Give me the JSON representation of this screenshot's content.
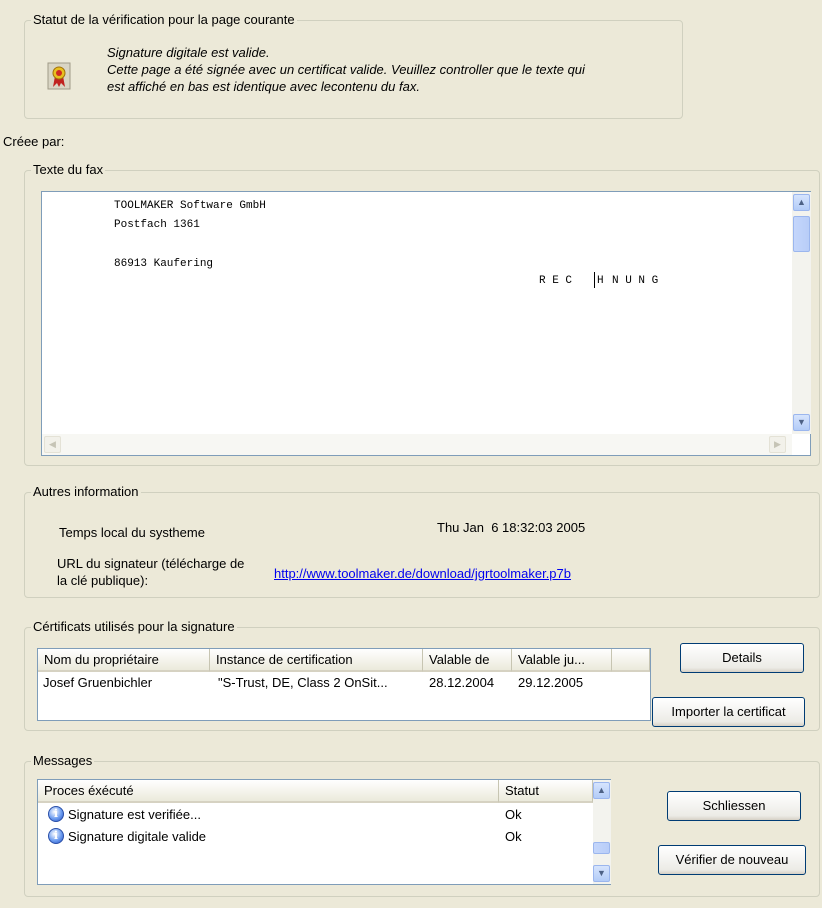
{
  "status": {
    "title": "Statut de la vérification pour la page courante",
    "icon": "certificate-ribbon-icon",
    "line1": "Signature digitale est valide.",
    "line2": "Cette page a été signée avec un certificat valide. Veuillez controller que le texte qui",
    "line3": "est affiché en bas est identique avec lecontenu du fax."
  },
  "created_by": "Créee par:",
  "fax": {
    "title": "Texte du fax",
    "lines": [
      "TOOLMAKER Software GmbH",
      "Postfach 1361",
      "86913 Kaufering"
    ],
    "heading_left": "R E C",
    "heading_right": "N U N G"
  },
  "other_info": {
    "title": "Autres information",
    "time_label": "Temps local du systheme",
    "time_value": "Thu Jan  6 18:32:03 2005",
    "url_label_1": "URL du signateur (télécharge de",
    "url_label_2": "la clé publique):",
    "url_value": "http://www.toolmaker.de/download/jgrtoolmaker.p7b"
  },
  "certificates": {
    "title": "Cértificats utilisés pour la signature",
    "columns": [
      "Nom du propriétaire",
      "Instance de certification",
      "Valable de",
      "Valable ju..."
    ],
    "rows": [
      [
        "Josef Gruenbichler",
        "\"S-Trust, DE, Class 2 OnSit...",
        "28.12.2004",
        "29.12.2005"
      ]
    ],
    "details_button": "Details",
    "import_button": "Importer la certificat"
  },
  "messages": {
    "title": "Messages",
    "columns": [
      "Proces éxécuté",
      "Statut"
    ],
    "rows": [
      {
        "process": "Signature est verifiée...",
        "status": "Ok",
        "icon": "info-icon"
      },
      {
        "process": "Signature digitale valide",
        "status": "Ok",
        "icon": "info-icon"
      }
    ],
    "close_button": "Schliessen",
    "verify_button": "Vérifier de nouveau"
  }
}
